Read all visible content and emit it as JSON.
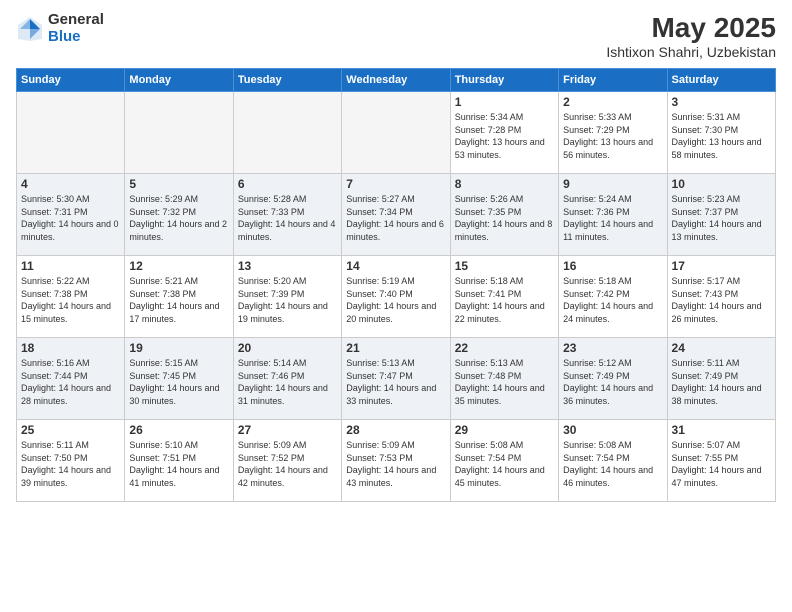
{
  "logo": {
    "general": "General",
    "blue": "Blue"
  },
  "title": "May 2025",
  "subtitle": "Ishtixon Shahri, Uzbekistan",
  "days_of_week": [
    "Sunday",
    "Monday",
    "Tuesday",
    "Wednesday",
    "Thursday",
    "Friday",
    "Saturday"
  ],
  "weeks": [
    [
      {
        "day": "",
        "info": ""
      },
      {
        "day": "",
        "info": ""
      },
      {
        "day": "",
        "info": ""
      },
      {
        "day": "",
        "info": ""
      },
      {
        "day": "1",
        "info": "Sunrise: 5:34 AM\nSunset: 7:28 PM\nDaylight: 13 hours\nand 53 minutes."
      },
      {
        "day": "2",
        "info": "Sunrise: 5:33 AM\nSunset: 7:29 PM\nDaylight: 13 hours\nand 56 minutes."
      },
      {
        "day": "3",
        "info": "Sunrise: 5:31 AM\nSunset: 7:30 PM\nDaylight: 13 hours\nand 58 minutes."
      }
    ],
    [
      {
        "day": "4",
        "info": "Sunrise: 5:30 AM\nSunset: 7:31 PM\nDaylight: 14 hours\nand 0 minutes."
      },
      {
        "day": "5",
        "info": "Sunrise: 5:29 AM\nSunset: 7:32 PM\nDaylight: 14 hours\nand 2 minutes."
      },
      {
        "day": "6",
        "info": "Sunrise: 5:28 AM\nSunset: 7:33 PM\nDaylight: 14 hours\nand 4 minutes."
      },
      {
        "day": "7",
        "info": "Sunrise: 5:27 AM\nSunset: 7:34 PM\nDaylight: 14 hours\nand 6 minutes."
      },
      {
        "day": "8",
        "info": "Sunrise: 5:26 AM\nSunset: 7:35 PM\nDaylight: 14 hours\nand 8 minutes."
      },
      {
        "day": "9",
        "info": "Sunrise: 5:24 AM\nSunset: 7:36 PM\nDaylight: 14 hours\nand 11 minutes."
      },
      {
        "day": "10",
        "info": "Sunrise: 5:23 AM\nSunset: 7:37 PM\nDaylight: 14 hours\nand 13 minutes."
      }
    ],
    [
      {
        "day": "11",
        "info": "Sunrise: 5:22 AM\nSunset: 7:38 PM\nDaylight: 14 hours\nand 15 minutes."
      },
      {
        "day": "12",
        "info": "Sunrise: 5:21 AM\nSunset: 7:38 PM\nDaylight: 14 hours\nand 17 minutes."
      },
      {
        "day": "13",
        "info": "Sunrise: 5:20 AM\nSunset: 7:39 PM\nDaylight: 14 hours\nand 19 minutes."
      },
      {
        "day": "14",
        "info": "Sunrise: 5:19 AM\nSunset: 7:40 PM\nDaylight: 14 hours\nand 20 minutes."
      },
      {
        "day": "15",
        "info": "Sunrise: 5:18 AM\nSunset: 7:41 PM\nDaylight: 14 hours\nand 22 minutes."
      },
      {
        "day": "16",
        "info": "Sunrise: 5:18 AM\nSunset: 7:42 PM\nDaylight: 14 hours\nand 24 minutes."
      },
      {
        "day": "17",
        "info": "Sunrise: 5:17 AM\nSunset: 7:43 PM\nDaylight: 14 hours\nand 26 minutes."
      }
    ],
    [
      {
        "day": "18",
        "info": "Sunrise: 5:16 AM\nSunset: 7:44 PM\nDaylight: 14 hours\nand 28 minutes."
      },
      {
        "day": "19",
        "info": "Sunrise: 5:15 AM\nSunset: 7:45 PM\nDaylight: 14 hours\nand 30 minutes."
      },
      {
        "day": "20",
        "info": "Sunrise: 5:14 AM\nSunset: 7:46 PM\nDaylight: 14 hours\nand 31 minutes."
      },
      {
        "day": "21",
        "info": "Sunrise: 5:13 AM\nSunset: 7:47 PM\nDaylight: 14 hours\nand 33 minutes."
      },
      {
        "day": "22",
        "info": "Sunrise: 5:13 AM\nSunset: 7:48 PM\nDaylight: 14 hours\nand 35 minutes."
      },
      {
        "day": "23",
        "info": "Sunrise: 5:12 AM\nSunset: 7:49 PM\nDaylight: 14 hours\nand 36 minutes."
      },
      {
        "day": "24",
        "info": "Sunrise: 5:11 AM\nSunset: 7:49 PM\nDaylight: 14 hours\nand 38 minutes."
      }
    ],
    [
      {
        "day": "25",
        "info": "Sunrise: 5:11 AM\nSunset: 7:50 PM\nDaylight: 14 hours\nand 39 minutes."
      },
      {
        "day": "26",
        "info": "Sunrise: 5:10 AM\nSunset: 7:51 PM\nDaylight: 14 hours\nand 41 minutes."
      },
      {
        "day": "27",
        "info": "Sunrise: 5:09 AM\nSunset: 7:52 PM\nDaylight: 14 hours\nand 42 minutes."
      },
      {
        "day": "28",
        "info": "Sunrise: 5:09 AM\nSunset: 7:53 PM\nDaylight: 14 hours\nand 43 minutes."
      },
      {
        "day": "29",
        "info": "Sunrise: 5:08 AM\nSunset: 7:54 PM\nDaylight: 14 hours\nand 45 minutes."
      },
      {
        "day": "30",
        "info": "Sunrise: 5:08 AM\nSunset: 7:54 PM\nDaylight: 14 hours\nand 46 minutes."
      },
      {
        "day": "31",
        "info": "Sunrise: 5:07 AM\nSunset: 7:55 PM\nDaylight: 14 hours\nand 47 minutes."
      }
    ]
  ]
}
